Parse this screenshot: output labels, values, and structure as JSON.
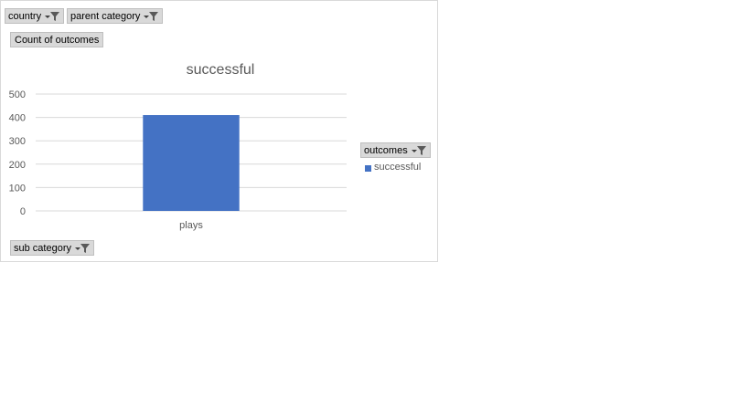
{
  "filters": {
    "country_label": "country",
    "parent_category_label": "parent category",
    "sub_category_label": "sub category",
    "outcomes_label": "outcomes"
  },
  "value_field_label": "Count of outcomes",
  "legend": {
    "items": [
      {
        "label": "successful",
        "color": "#4472c4"
      }
    ]
  },
  "colors": {
    "bar": "#4472c4",
    "gridline": "#d9d9d9",
    "axis_text": "#595959",
    "field_button_bg": "#d9d9d9"
  },
  "chart_data": {
    "type": "bar",
    "title": "successful",
    "categories": [
      "plays"
    ],
    "series": [
      {
        "name": "successful",
        "values": [
          410
        ]
      }
    ],
    "ylim": [
      0,
      500
    ],
    "yticks": [
      0,
      100,
      200,
      300,
      400,
      500
    ],
    "grid": true,
    "legend_position": "right"
  }
}
